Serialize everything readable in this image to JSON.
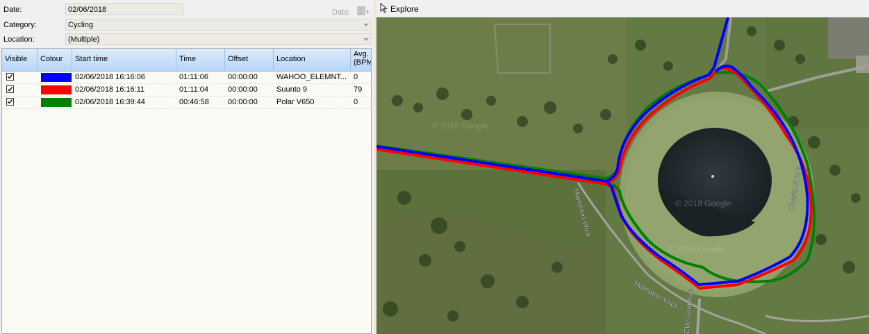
{
  "form": {
    "date_label": "Date:",
    "date_value": "02/06/2018",
    "category_label": "Category:",
    "category_value": "Cycling",
    "location_label": "Location:",
    "location_value": "(Multiple)",
    "data_label": "Data:"
  },
  "grid": {
    "columns": [
      "Visible",
      "Colour",
      "Start time",
      "Time",
      "Offset",
      "Location",
      "Avg. (BPM"
    ],
    "rows": [
      {
        "visible": true,
        "colour": "#0000ff",
        "start_time": "02/06/2018 16:16:06",
        "time": "01:11:06",
        "offset": "00:00:00",
        "location": "WAHOO_ELEMNT...",
        "avg": "0"
      },
      {
        "visible": true,
        "colour": "#ff0000",
        "start_time": "02/06/2018 16:16:11",
        "time": "01:11:04",
        "offset": "00:00:00",
        "location": "Suunto 9",
        "avg": "79"
      },
      {
        "visible": true,
        "colour": "#008000",
        "start_time": "02/06/2018 16:39:44",
        "time": "00:46:58",
        "offset": "00:00:00",
        "location": "Polar V650",
        "avg": "0"
      }
    ]
  },
  "toolbar": {
    "explore_label": "Explore"
  },
  "map": {
    "road_labels": [
      "Hampton Wick",
      "Hampton Wick",
      "Chestnut Ave",
      "Chestnut Ave"
    ],
    "watermarks": [
      "© 2018 Google",
      "© 2018 Google",
      "© 2018 Google"
    ],
    "track_colors": {
      "blue": "#0000ff",
      "red": "#ff0000",
      "green": "#008000"
    }
  }
}
